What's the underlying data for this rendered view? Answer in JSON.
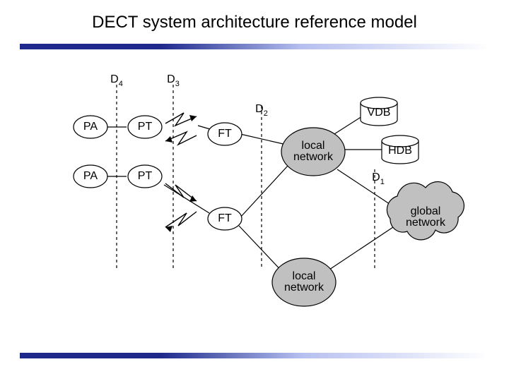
{
  "title": "DECT system architecture reference model",
  "labels": {
    "PA": "PA",
    "PT": "PT",
    "FT": "FT",
    "VDB": "VDB",
    "HDB": "HDB",
    "local_network": "local network",
    "global_network": "global network",
    "D1": "D",
    "D1s": "1",
    "D2": "D",
    "D2s": "2",
    "D3": "D",
    "D3s": "3",
    "D4": "D",
    "D4s": "4"
  }
}
